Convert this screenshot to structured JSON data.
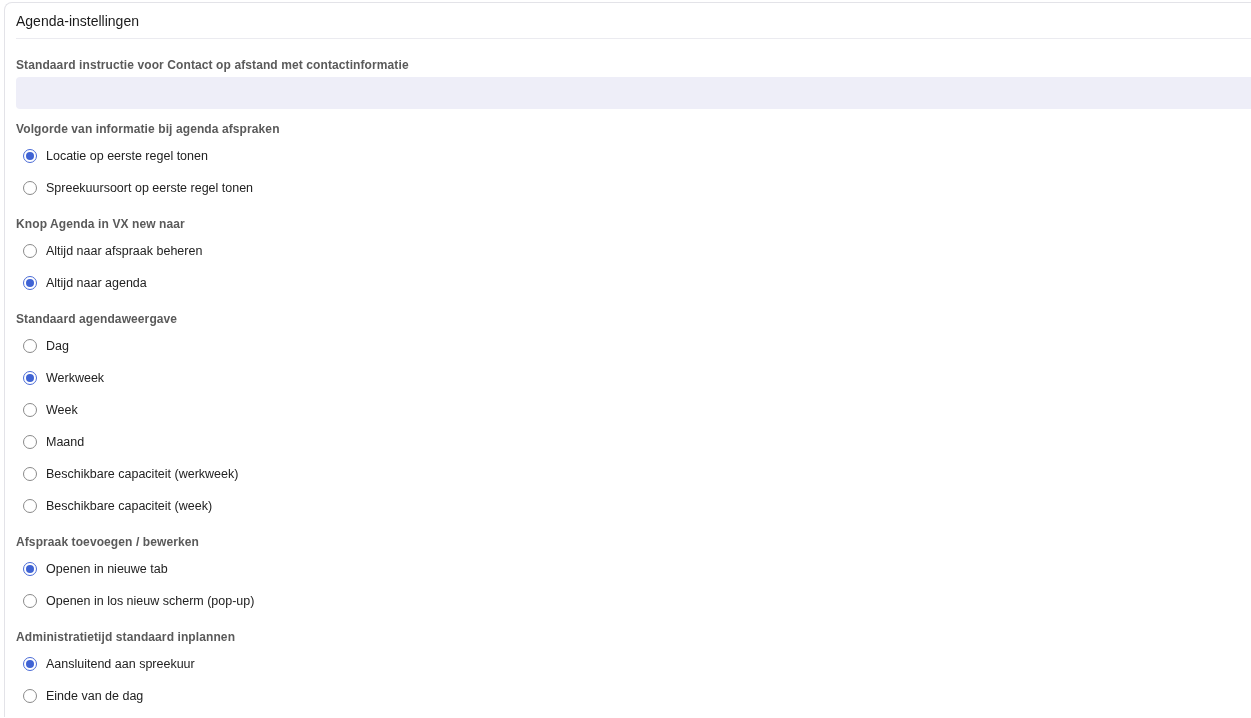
{
  "card": {
    "title": "Agenda-instellingen"
  },
  "text_field": {
    "label": "Standaard instructie voor Contact op afstand met contactinformatie"
  },
  "groups": [
    {
      "label": "Volgorde van informatie bij agenda afspraken",
      "options": [
        {
          "label": "Locatie op eerste regel tonen",
          "selected": true
        },
        {
          "label": "Spreekuursoort op eerste regel tonen",
          "selected": false
        }
      ]
    },
    {
      "label": "Knop Agenda in VX new naar",
      "options": [
        {
          "label": "Altijd naar afspraak beheren",
          "selected": false
        },
        {
          "label": "Altijd naar agenda",
          "selected": true
        }
      ]
    },
    {
      "label": "Standaard agendaweergave",
      "options": [
        {
          "label": "Dag",
          "selected": false
        },
        {
          "label": "Werkweek",
          "selected": true
        },
        {
          "label": "Week",
          "selected": false
        },
        {
          "label": "Maand",
          "selected": false
        },
        {
          "label": "Beschikbare capaciteit (werkweek)",
          "selected": false
        },
        {
          "label": "Beschikbare capaciteit (week)",
          "selected": false
        }
      ]
    },
    {
      "label": "Afspraak toevoegen / bewerken",
      "options": [
        {
          "label": "Openen in nieuwe tab",
          "selected": true
        },
        {
          "label": "Openen in los nieuw scherm (pop-up)",
          "selected": false
        }
      ]
    },
    {
      "label": "Administratietijd standaard inplannen",
      "options": [
        {
          "label": "Aansluitend aan spreekuur",
          "selected": true
        },
        {
          "label": "Einde van de dag",
          "selected": false
        }
      ]
    }
  ]
}
